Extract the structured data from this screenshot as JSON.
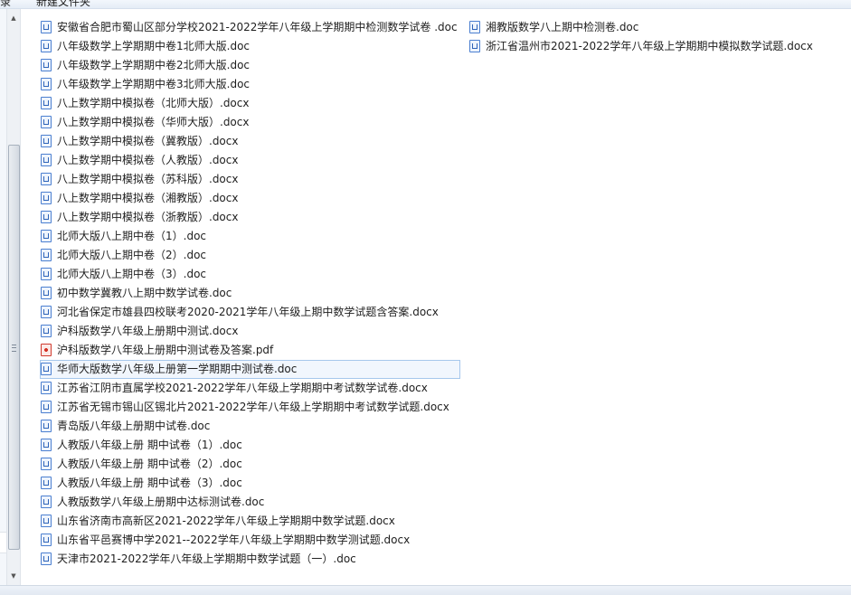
{
  "toolbar": {
    "item1": "录",
    "item2": "新建文件夹"
  },
  "files_left": [
    {
      "name": "安徽省合肥市蜀山区部分学校2021-2022学年八年级上学期期中检测数学试卷 .doc",
      "type": "doc"
    },
    {
      "name": "八年级数学上学期期中卷1北师大版.doc",
      "type": "doc"
    },
    {
      "name": "八年级数学上学期期中卷2北师大版.doc",
      "type": "doc"
    },
    {
      "name": "八年级数学上学期期中卷3北师大版.doc",
      "type": "doc"
    },
    {
      "name": "八上数学期中模拟卷（北师大版）.docx",
      "type": "doc"
    },
    {
      "name": "八上数学期中模拟卷（华师大版）.docx",
      "type": "doc"
    },
    {
      "name": "八上数学期中模拟卷（冀教版）.docx",
      "type": "doc"
    },
    {
      "name": "八上数学期中模拟卷（人教版）.docx",
      "type": "doc"
    },
    {
      "name": "八上数学期中模拟卷（苏科版）.docx",
      "type": "doc"
    },
    {
      "name": "八上数学期中模拟卷（湘教版）.docx",
      "type": "doc"
    },
    {
      "name": "八上数学期中模拟卷（浙教版）.docx",
      "type": "doc"
    },
    {
      "name": "北师大版八上期中卷（1）.doc",
      "type": "doc"
    },
    {
      "name": "北师大版八上期中卷（2）.doc",
      "type": "doc"
    },
    {
      "name": "北师大版八上期中卷（3）.doc",
      "type": "doc"
    },
    {
      "name": "初中数学冀教八上期中数学试卷.doc",
      "type": "doc"
    },
    {
      "name": "河北省保定市雄县四校联考2020-2021学年八年级上期中数学试题含答案.docx",
      "type": "doc"
    },
    {
      "name": "沪科版数学八年级上册期中测试.docx",
      "type": "doc"
    },
    {
      "name": "沪科版数学八年级上册期中测试卷及答案.pdf",
      "type": "pdf"
    },
    {
      "name": "华师大版数学八年级上册第一学期期中测试卷.doc",
      "type": "doc",
      "selected": true
    },
    {
      "name": "江苏省江阴市直属学校2021-2022学年八年级上学期期中考试数学试卷.docx",
      "type": "doc"
    },
    {
      "name": "江苏省无锡市锡山区锡北片2021-2022学年八年级上学期期中考试数学试题.docx",
      "type": "doc"
    },
    {
      "name": "青岛版八年级上册期中试卷.doc",
      "type": "doc"
    },
    {
      "name": "人教版八年级上册 期中试卷（1）.doc",
      "type": "doc"
    },
    {
      "name": "人教版八年级上册 期中试卷（2）.doc",
      "type": "doc"
    },
    {
      "name": "人教版八年级上册 期中试卷（3）.doc",
      "type": "doc"
    },
    {
      "name": "人教版数学八年级上册期中达标测试卷.doc",
      "type": "doc"
    },
    {
      "name": "山东省济南市高新区2021-2022学年八年级上学期期中数学试题.docx",
      "type": "doc"
    },
    {
      "name": "山东省平邑赛博中学2021--2022学年八年级上学期期中数学测试题.docx",
      "type": "doc"
    },
    {
      "name": "天津市2021-2022学年八年级上学期期中数学试题（一）.doc",
      "type": "doc"
    }
  ],
  "files_right": [
    {
      "name": "湘教版数学八上期中检测卷.doc",
      "type": "doc"
    },
    {
      "name": "浙江省温州市2021-2022学年八年级上学期期中模拟数学试题.docx",
      "type": "doc"
    }
  ],
  "icons": {
    "doc": "word-doc-icon",
    "pdf": "pdf-icon"
  }
}
